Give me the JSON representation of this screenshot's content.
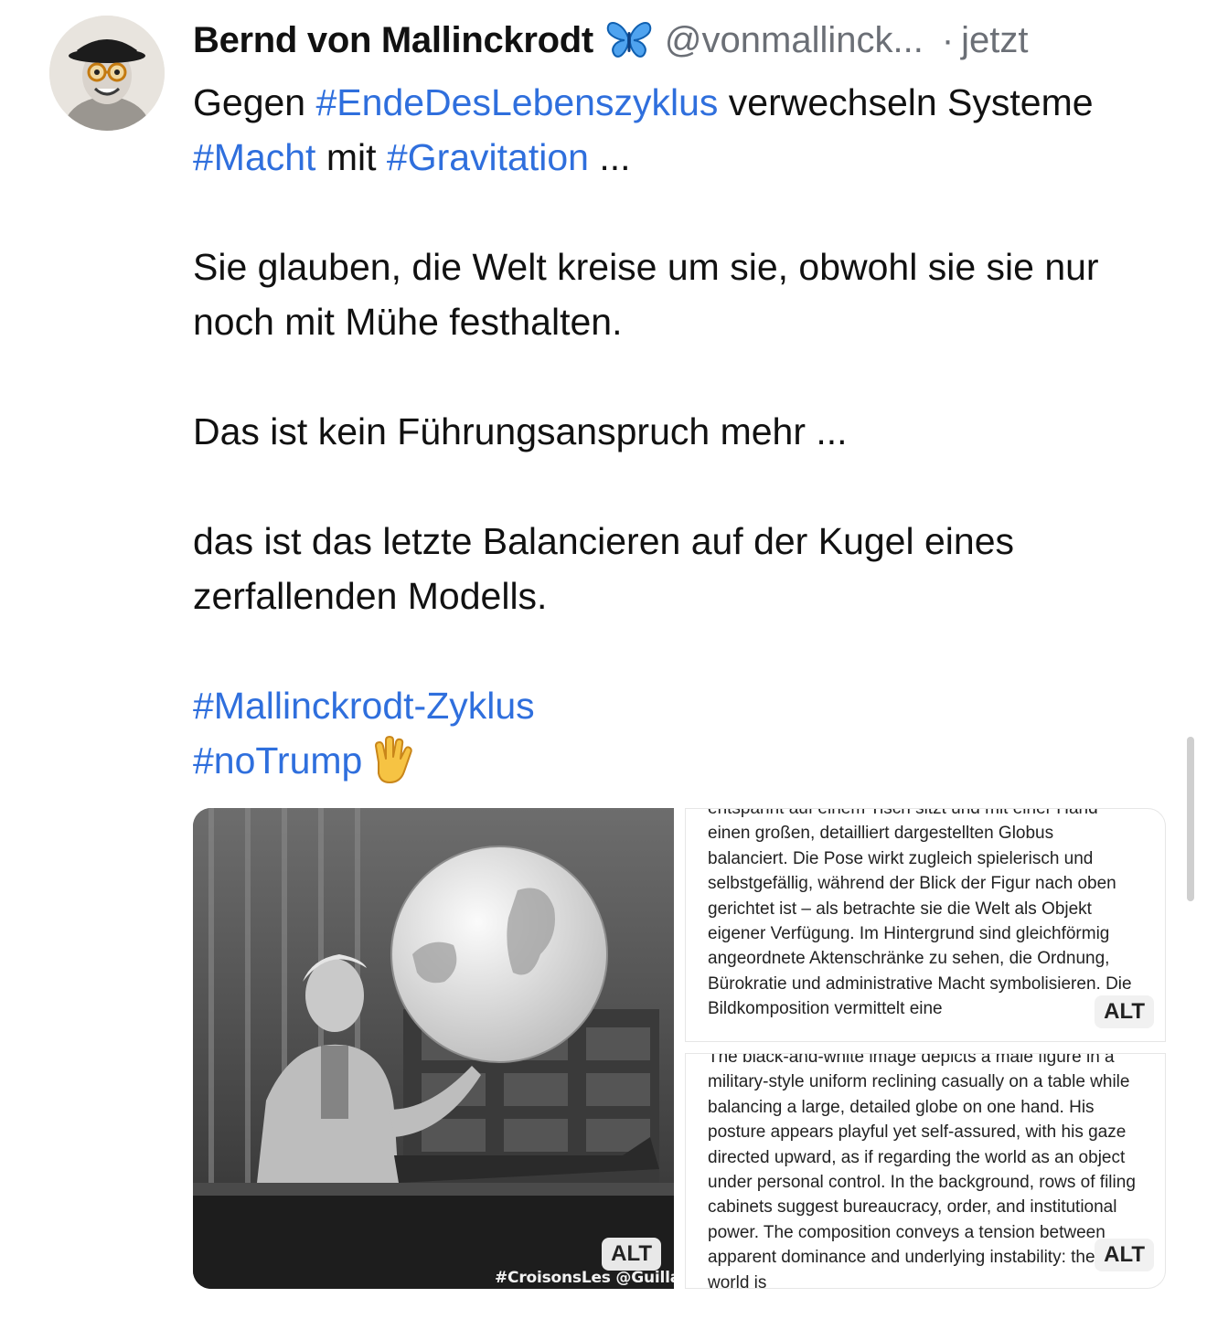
{
  "post": {
    "author": {
      "display_name": "Bernd von Mallinckrodt",
      "badge_icon": "butterfly-icon",
      "handle": "@vonmallinck...",
      "separator": "·",
      "time": "jetzt"
    },
    "text": {
      "p1_pre": "Gegen ",
      "p1_tag1": "#EndeDesLebenszyklus",
      "p1_mid1": " verwechseln Systeme ",
      "p1_tag2": "#Macht",
      "p1_mid2": " mit ",
      "p1_tag3": "#Gravitation",
      "p1_post": " ...",
      "p2": "Sie glauben, die Welt kreise um sie, obwohl sie sie nur noch mit Mühe festhalten.",
      "p3": "Das ist kein Führungsanspruch mehr ...",
      "p4": "das ist das letzte Balancieren auf der Kugel eines zerfallenden Modells.",
      "tag_mallinckrodt": "#Mallinckrodt-Zyklus",
      "tag_notrump": "#noTrump",
      "emoji_icon": "raised-hand-vulcan-icon"
    },
    "media": {
      "image1": {
        "alt_badge": "ALT",
        "watermark": "#CroisonsLes @Guillaum"
      },
      "image2": {
        "alt_badge": "ALT",
        "text": "entspannt auf einem Tisch sitzt und mit einer Hand einen großen, detailliert dargestellten Globus balanciert. Die Pose wirkt zugleich spielerisch und selbstgefällig, während der Blick der Figur nach oben gerichtet ist – als betrachte sie die Welt als Objekt eigener Verfügung. Im Hintergrund sind gleichförmig angeordnete Aktenschränke zu sehen, die Ordnung, Bürokratie und administrative Macht symbolisieren. Die Bildkomposition vermittelt eine"
      },
      "image3": {
        "alt_badge": "ALT",
        "text": "The black-and-white image depicts a male figure in a military-style uniform reclining casually on a table while balancing a large, detailed globe on one hand. His posture appears playful yet self-assured, with his gaze directed upward, as if regarding the world as an object under personal control. In the background, rows of filing cabinets suggest bureaucracy, order, and institutional power. The composition conveys a tension between apparent dominance and underlying instability: the world is"
      }
    }
  }
}
